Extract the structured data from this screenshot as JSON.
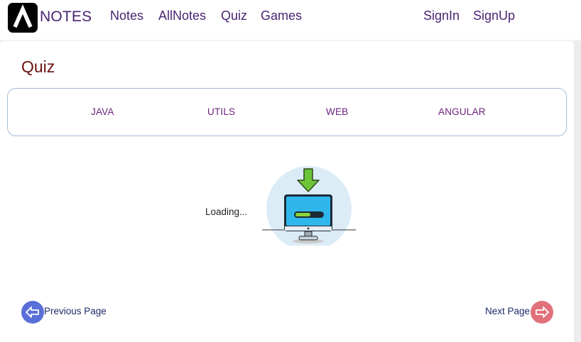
{
  "header": {
    "brand": "NOTES",
    "nav": [
      "Notes",
      "AllNotes",
      "Quiz",
      "Games"
    ],
    "auth": [
      "SignIn",
      "SignUp"
    ]
  },
  "main": {
    "title": "Quiz",
    "tabs": [
      "JAVA",
      "UTILS",
      "WEB",
      "ANGULAR"
    ],
    "loading_text": "Loading...",
    "download_progress": 0.55
  },
  "pagination": {
    "previous_label": "Previous Page",
    "next_label": "Next Page"
  },
  "colors": {
    "brand_purple": "#4a2372",
    "title_maroon": "#6a0f0f",
    "tab_purple": "#6b1f7c",
    "prev_button": "#5a70d8",
    "next_button": "#e0707a",
    "progress_green": "#8bd43a"
  },
  "icons": [
    "logo-icon",
    "download-arrow-icon",
    "monitor-icon",
    "arrow-left-icon",
    "arrow-right-icon"
  ]
}
